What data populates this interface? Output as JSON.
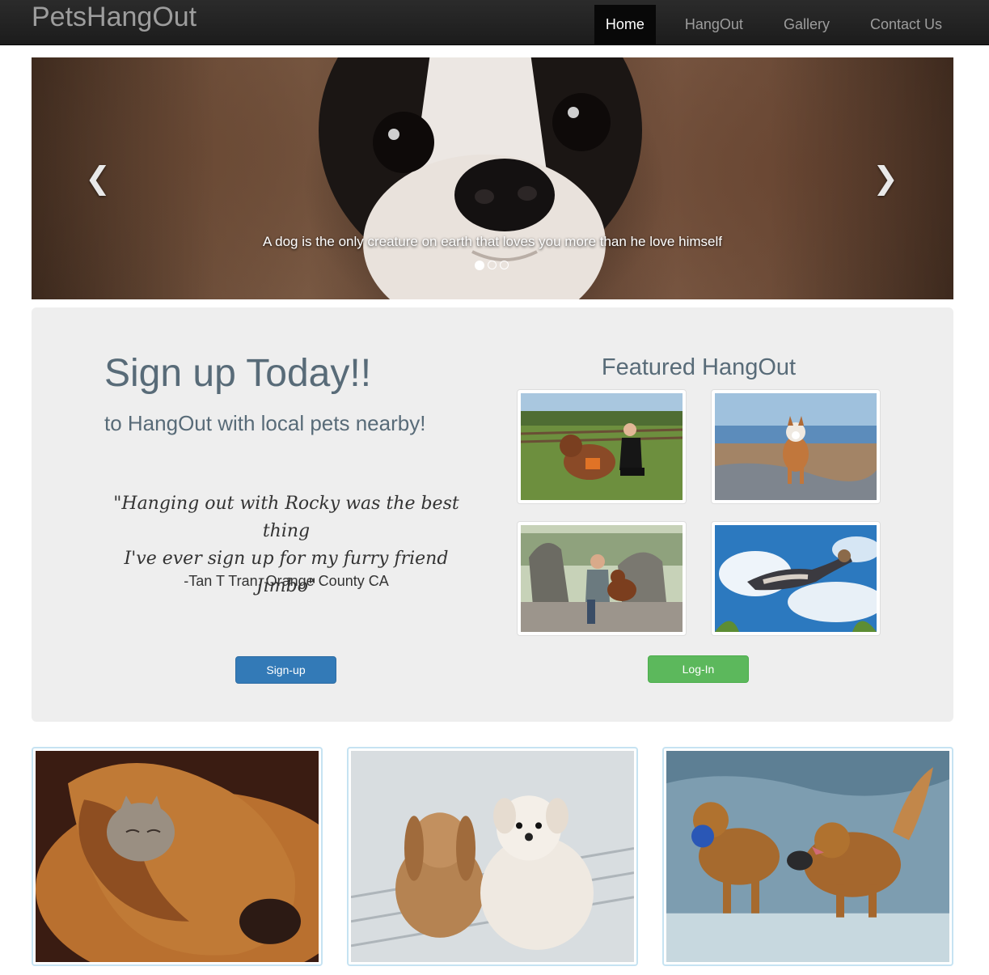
{
  "brand": "PetsHangOut",
  "nav": {
    "items": [
      {
        "label": "Home",
        "active": true
      },
      {
        "label": "HangOut",
        "active": false
      },
      {
        "label": "Gallery",
        "active": false
      },
      {
        "label": "Contact Us",
        "active": false
      }
    ]
  },
  "carousel": {
    "caption": "A dog is the only creature on earth that loves you more than he love himself",
    "prev_icon": "chevron-left-icon",
    "next_icon": "chevron-right-icon",
    "slide_count": 3,
    "active_slide": 1
  },
  "signup": {
    "title": "Sign up Today!!",
    "subtitle": "to HangOut with local pets nearby!",
    "quote_line1": "\"Hanging out with Rocky was the best thing",
    "quote_line2": "I've ever sign up for my furry friend Jimbo\"",
    "quote_author": "-Tan T Tran, Orange County CA",
    "signup_button": "Sign-up",
    "login_button": "Log-In"
  },
  "featured": {
    "title": "Featured HangOut"
  },
  "colors": {
    "navbar": "#222222",
    "primary": "#337ab7",
    "success": "#5cb85c",
    "jumbotron": "#eeeeee",
    "heading": "#586b78"
  }
}
